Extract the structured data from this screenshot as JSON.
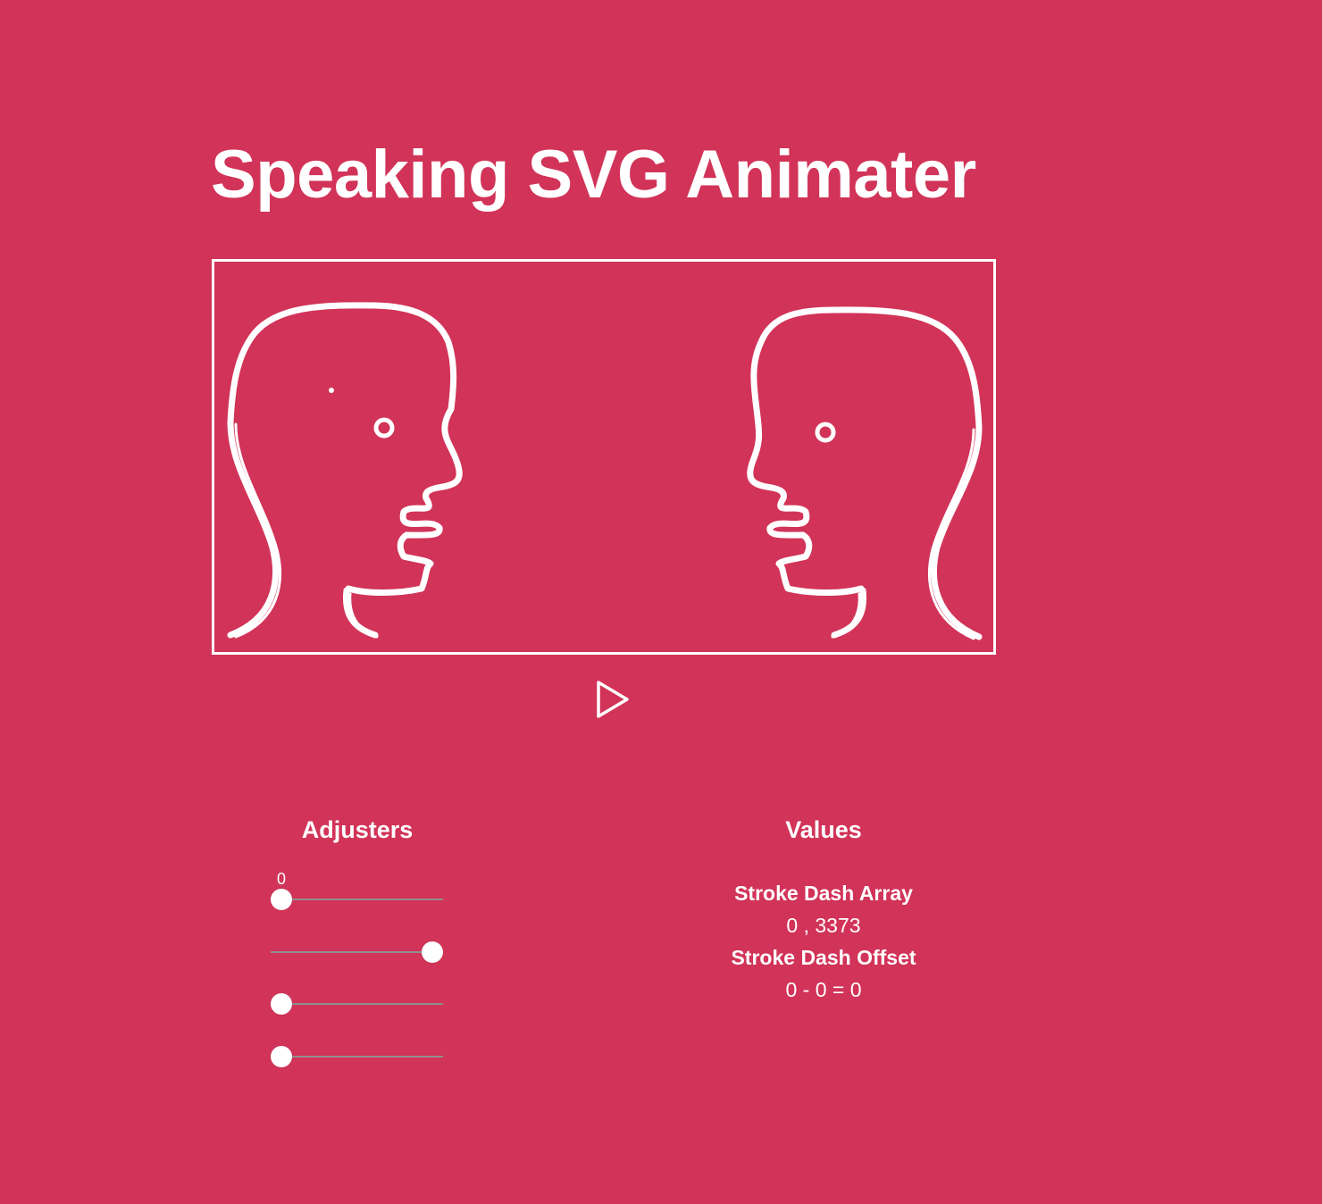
{
  "page": {
    "title": "Speaking SVG Animater",
    "background_color": "#d23358",
    "foreground_color": "#ffffff"
  },
  "animation": {
    "play_icon": "play-icon"
  },
  "adjusters": {
    "heading": "Adjusters",
    "sliders": [
      {
        "name": "slider-1",
        "value_label": "0",
        "fraction": 0.0
      },
      {
        "name": "slider-2",
        "fraction": 1.0
      },
      {
        "name": "slider-3",
        "fraction": 0.0
      },
      {
        "name": "slider-4",
        "fraction": 0.0
      }
    ]
  },
  "values": {
    "heading": "Values",
    "stroke_dash_array_label": "Stroke Dash Array",
    "stroke_dash_array_value": "0 , 3373",
    "stroke_dash_offset_label": "Stroke Dash Offset",
    "stroke_dash_offset_value": "0 - 0 = 0"
  }
}
